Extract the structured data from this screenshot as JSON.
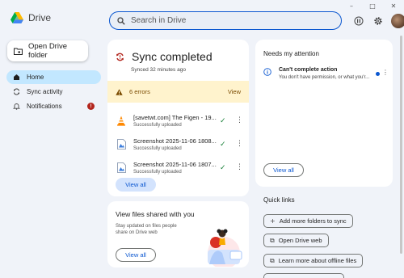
{
  "app": {
    "name": "Drive"
  },
  "window_controls": {
    "minimize": "–",
    "maximize": "□",
    "close": "✕"
  },
  "search": {
    "placeholder": "Search in Drive"
  },
  "sidebar": {
    "open_folder_label": "Open Drive folder",
    "items": [
      {
        "label": "Home",
        "icon": "home-icon",
        "active": true
      },
      {
        "label": "Sync activity",
        "icon": "sync-icon"
      },
      {
        "label": "Notifications",
        "icon": "bell-icon",
        "badge": "!"
      }
    ]
  },
  "sync_card": {
    "title": "Sync completed",
    "subtitle": "Synced 32 minutes ago",
    "errors_label": "6 errors",
    "errors_action": "View",
    "files": [
      {
        "name": "[savetwt.com] The Figen - 19...",
        "status": "Successfully uploaded",
        "icon": "vlc-icon"
      },
      {
        "name": "Screenshot 2025-11-06 1808...",
        "status": "Successfully uploaded",
        "icon": "image-file-icon"
      },
      {
        "name": "Screenshot 2025-11-06 1807...",
        "status": "Successfully uploaded",
        "icon": "image-file-icon"
      }
    ],
    "view_all": "View all"
  },
  "share_card": {
    "title": "View files shared with you",
    "description": "Stay updated on files people share on Drive web",
    "view_all": "View all"
  },
  "attention_card": {
    "title": "Needs my attention",
    "item_title": "Can't complete action",
    "item_desc": "You don't have permission, or what you'r...",
    "view_all": "View all"
  },
  "quick_links": {
    "title": "Quick links",
    "items": [
      {
        "label": "Add more folders to sync",
        "icon": "plus-icon"
      },
      {
        "label": "Open Drive web",
        "icon": "open-external-icon"
      },
      {
        "label": "Learn more about offline files",
        "icon": "open-external-icon"
      },
      {
        "label": "",
        "icon": "open-external-icon"
      }
    ]
  },
  "colors": {
    "accent": "#0b57d0",
    "active_nav": "#c2e7ff",
    "error_bg": "#fff3cd",
    "error_badge": "#b3261e",
    "success": "#188038"
  }
}
